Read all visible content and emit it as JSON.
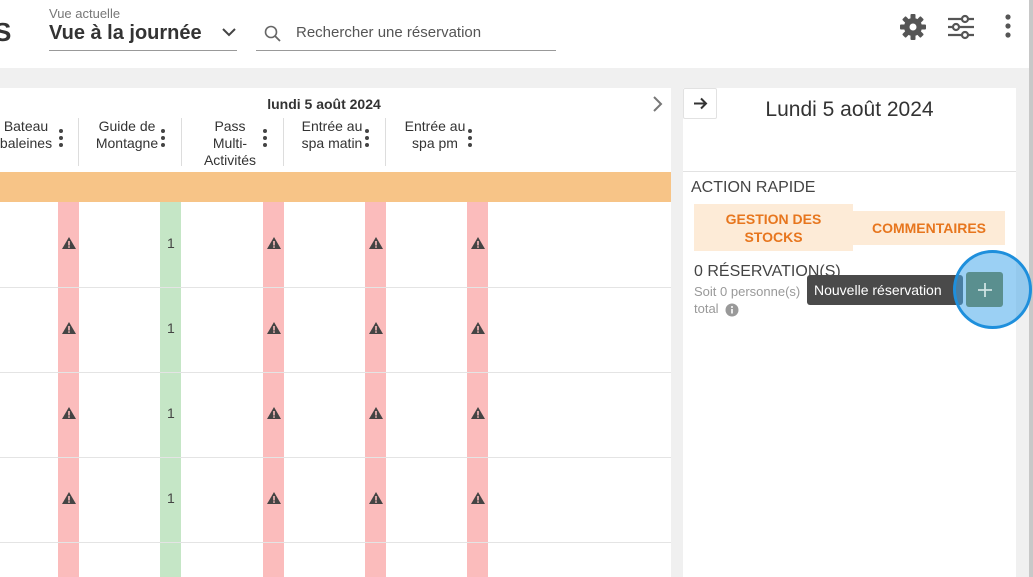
{
  "app": {
    "brand_fragment": "S"
  },
  "header": {
    "view_label": "Vue actuelle",
    "view_value": "Vue à la journée",
    "search_placeholder": "Rechercher une réservation",
    "icons": [
      "gear-icon",
      "sliders-icon",
      "more-vertical-icon"
    ]
  },
  "grid": {
    "date_title": "lundi 5 août 2024",
    "columns": [
      {
        "label": "Bateau baleines",
        "lines": [
          "Bateau",
          "baleines"
        ],
        "status_color": "#fbbcbc",
        "cells": [
          "warn",
          "warn",
          "warn",
          "warn"
        ]
      },
      {
        "label": "Guide de Montagne",
        "lines": [
          "Guide de",
          "Montagne"
        ],
        "status_color": "#c5e6c6",
        "cells": [
          "1",
          "1",
          "1",
          "1"
        ]
      },
      {
        "label": "Pass Multi-Activités",
        "lines": [
          "Pass",
          "Multi-",
          "Activités"
        ],
        "status_color": "#fbbcbc",
        "cells": [
          "warn",
          "warn",
          "warn",
          "warn"
        ]
      },
      {
        "label": "Entrée au spa matin",
        "lines": [
          "Entrée au",
          "spa matin"
        ],
        "status_color": "#fbbcbc",
        "cells": [
          "warn",
          "warn",
          "warn",
          "warn"
        ]
      },
      {
        "label": "Entrée au spa pm",
        "lines": [
          "Entrée au",
          "spa pm"
        ],
        "status_color": "#fbbcbc",
        "cells": [
          "warn",
          "warn",
          "warn",
          "warn"
        ]
      }
    ],
    "highlight_color": "#f7c487"
  },
  "panel": {
    "date": "Lundi 5 août 2024",
    "quick_action_title": "ACTION RAPIDE",
    "btn_stocks_line1": "GESTION DES",
    "btn_stocks_line2": "STOCKS",
    "btn_comments": "COMMENTAIRES",
    "reservations": "0 RÉSERVATION(S)",
    "persons": "Soit 0 personne(s)",
    "total": "total",
    "tooltip": "Nouvelle réservation",
    "accent": "#e7761e"
  }
}
